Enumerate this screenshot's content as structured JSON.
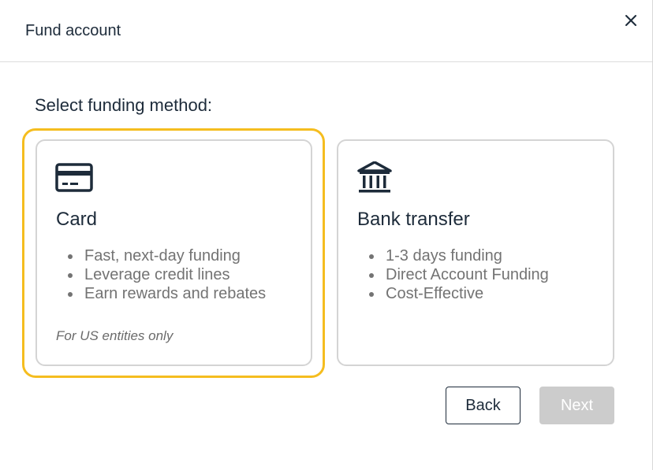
{
  "dialog": {
    "title": "Fund account",
    "close_icon": "close-icon"
  },
  "section_title": "Select funding method:",
  "options": [
    {
      "title": "Card",
      "icon": "credit-card-icon",
      "selected": true,
      "features": [
        "Fast, next-day funding",
        "Leverage credit lines",
        "Earn rewards and rebates"
      ],
      "note": "For US entities only"
    },
    {
      "title": "Bank transfer",
      "icon": "bank-icon",
      "selected": false,
      "features": [
        "1-3 days funding",
        "Direct Account Funding",
        "Cost-Effective"
      ]
    }
  ],
  "buttons": {
    "back": "Back",
    "next": "Next",
    "next_disabled": true
  },
  "colors": {
    "focus_ring": "#f5bd1f",
    "text_dark": "#1d2b3a",
    "text_muted": "#737373",
    "disabled_button": "#cccccc"
  }
}
